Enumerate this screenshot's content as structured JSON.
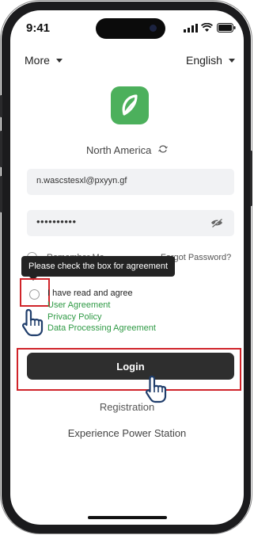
{
  "status_bar": {
    "time": "9:41"
  },
  "header": {
    "more_label": "More",
    "language_label": "English"
  },
  "region": {
    "label": "North America"
  },
  "login_form": {
    "email_value": "n.wascstesxl@pxyyn.gf",
    "password_value": "••••••••••",
    "remember_label": "Remember Me",
    "forgot_label": "Forgot Password?"
  },
  "tooltip": {
    "text": "Please check the box for agreement"
  },
  "agreement": {
    "prefix": "I have read and agree",
    "user_agreement": "User Agreement",
    "privacy_policy": "Privacy Policy",
    "data_processing": "Data Processing Agreement"
  },
  "buttons": {
    "login": "Login",
    "registration": "Registration",
    "experience": "Experience Power Station"
  },
  "colors": {
    "brand_green": "#4cb05c",
    "link_green": "#2f9a45",
    "highlight_red": "#d0242a",
    "button_dark": "#2e2e2e"
  },
  "icons": [
    "phone-frame",
    "app-logo-leaf-icon",
    "switch-region-icon",
    "hide-password-icon",
    "pointing-hand-icon",
    "signal-icon",
    "wifi-icon",
    "battery-icon"
  ]
}
